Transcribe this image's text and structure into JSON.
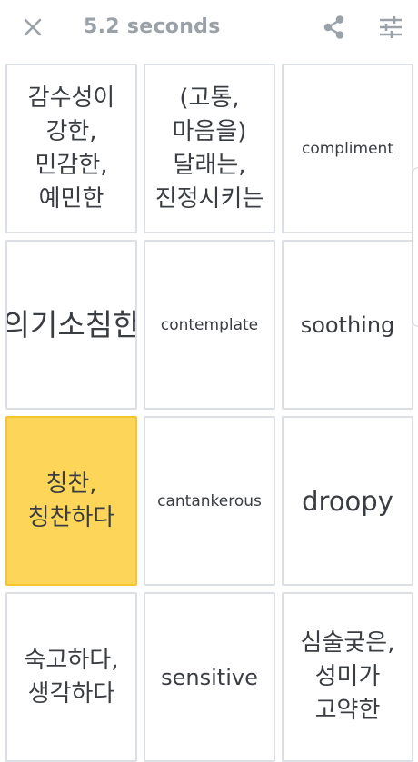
{
  "header": {
    "timer": "5.2 seconds",
    "close_icon": "close-icon",
    "share_icon": "share-icon",
    "settings_icon": "sliders-icon"
  },
  "colors": {
    "selected_tile": "#fdd559",
    "tile_border": "#dcdfe3",
    "text": "#3a3d42",
    "timer_text": "#9aa1a8"
  },
  "tiles": [
    {
      "text": "감수성이 강한, 민감한, 예민한",
      "selected": false
    },
    {
      "text": "(고통, 마음을) 달래는, 진정시키는",
      "selected": false
    },
    {
      "text": "compliment",
      "selected": false
    },
    {
      "text": "의기소침한",
      "selected": false
    },
    {
      "text": "contemplate",
      "selected": false
    },
    {
      "text": "soothing",
      "selected": false
    },
    {
      "text": "칭찬, 칭찬하다",
      "selected": true
    },
    {
      "text": "cantankerous",
      "selected": false
    },
    {
      "text": "droopy",
      "selected": false
    },
    {
      "text": "숙고하다, 생각하다",
      "selected": false
    },
    {
      "text": "sensitive",
      "selected": false
    },
    {
      "text": "심술궂은, 성미가 고약한",
      "selected": false
    }
  ]
}
